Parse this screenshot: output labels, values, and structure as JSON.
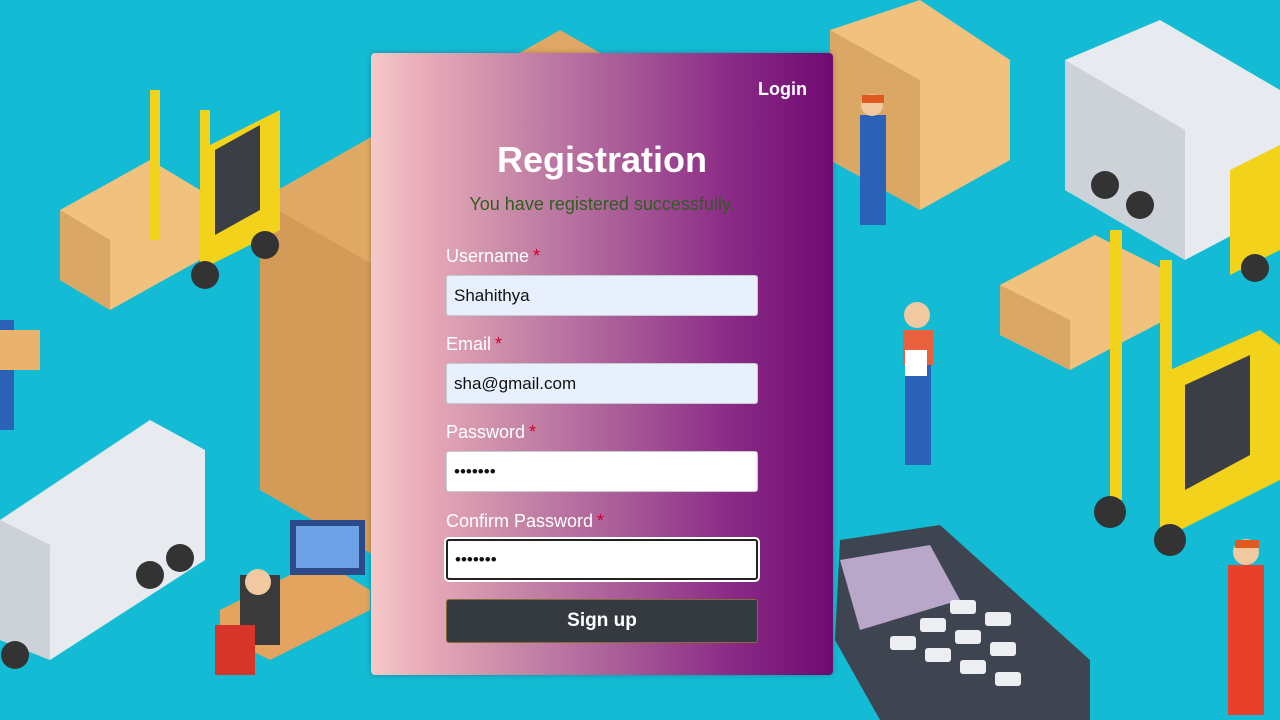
{
  "page": {
    "login_link": "Login",
    "title": "Registration",
    "success_message": "You have registered successfully."
  },
  "form": {
    "username": {
      "label": "Username",
      "required_mark": "*",
      "value": "Shahithya"
    },
    "email": {
      "label": "Email",
      "required_mark": "*",
      "value": "sha@gmail.com"
    },
    "password": {
      "label": "Password",
      "required_mark": "*",
      "value": "1234567"
    },
    "confirm_password": {
      "label": "Confirm Password",
      "required_mark": "*",
      "value": "1234567"
    },
    "submit_label": "Sign up"
  },
  "colors": {
    "background": "#13bcd4",
    "button": "#343a40",
    "success_text": "#2e5e1e",
    "required_mark": "#d0002a"
  }
}
